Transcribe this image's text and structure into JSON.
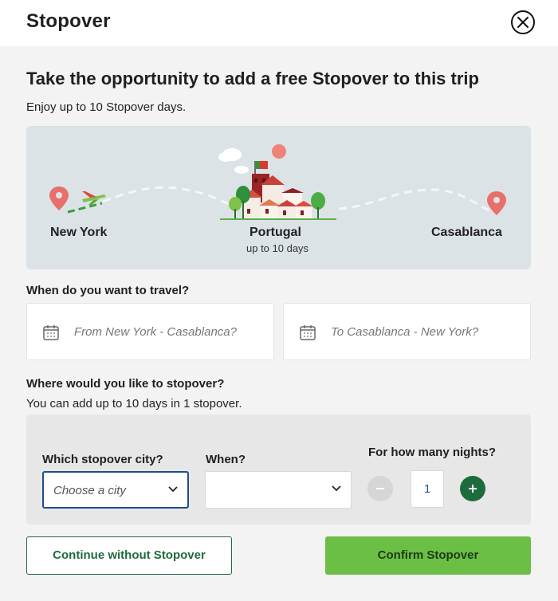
{
  "header": {
    "title": "Stopover",
    "close_icon": "close-icon"
  },
  "promo": {
    "headline": "Take the opportunity to add a free Stopover to this trip",
    "subtitle": "Enjoy up to 10 Stopover days."
  },
  "route": {
    "origin": "New York",
    "stopover": "Portugal",
    "stopover_sub": "up to 10 days",
    "destination": "Casablanca",
    "icons": [
      "location-pin-icon",
      "airplane-icon",
      "portugal-town-illustration",
      "location-pin-icon"
    ]
  },
  "travel": {
    "question": "When do you want to travel?",
    "outbound_placeholder": "From New York - Casablanca?",
    "return_placeholder": "To Casablanca - New York?",
    "icon": "calendar-icon"
  },
  "stopover": {
    "question": "Where would you like to stopover?",
    "note": "You can add up to 10 days in 1 stopover.",
    "city_label": "Which stopover city?",
    "city_value": "Choose a city",
    "when_label": "When?",
    "when_value": "",
    "nights_label": "For how many nights?",
    "nights_value": "1"
  },
  "actions": {
    "continue_label": "Continue without Stopover",
    "confirm_label": "Confirm Stopover"
  },
  "colors": {
    "brand_green": "#1e6b3c",
    "confirm_green": "#6cbf45",
    "focus_blue": "#1c4f8f",
    "pin_red": "#e8706a",
    "card_bg": "#dce3e6"
  }
}
